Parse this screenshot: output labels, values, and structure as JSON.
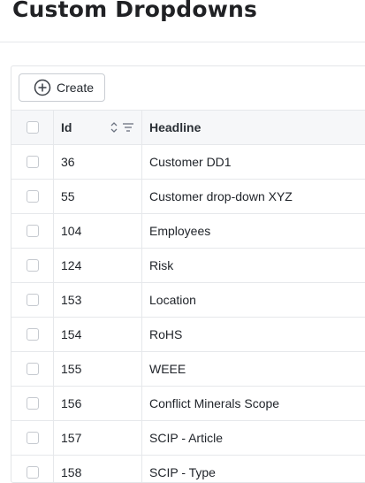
{
  "page": {
    "title": "Custom Dropdowns"
  },
  "toolbar": {
    "create_label": "Create"
  },
  "table": {
    "columns": {
      "id": "Id",
      "headline": "Headline"
    },
    "rows": [
      {
        "id": "36",
        "headline": "Customer DD1"
      },
      {
        "id": "55",
        "headline": "Customer drop-down XYZ"
      },
      {
        "id": "104",
        "headline": "Employees"
      },
      {
        "id": "124",
        "headline": "Risk"
      },
      {
        "id": "153",
        "headline": "Location"
      },
      {
        "id": "154",
        "headline": "RoHS"
      },
      {
        "id": "155",
        "headline": "WEEE"
      },
      {
        "id": "156",
        "headline": "Conflict Minerals Scope"
      },
      {
        "id": "157",
        "headline": "SCIP - Article"
      },
      {
        "id": "158",
        "headline": "SCIP - Type"
      }
    ]
  },
  "icons": {
    "create": "plus-circle-icon",
    "sort": "sort-arrows-icon",
    "filter": "filter-lines-icon"
  },
  "colors": {
    "header_bg": "#f6f7f9",
    "border": "#e6e8eb",
    "text": "#1f2329"
  }
}
